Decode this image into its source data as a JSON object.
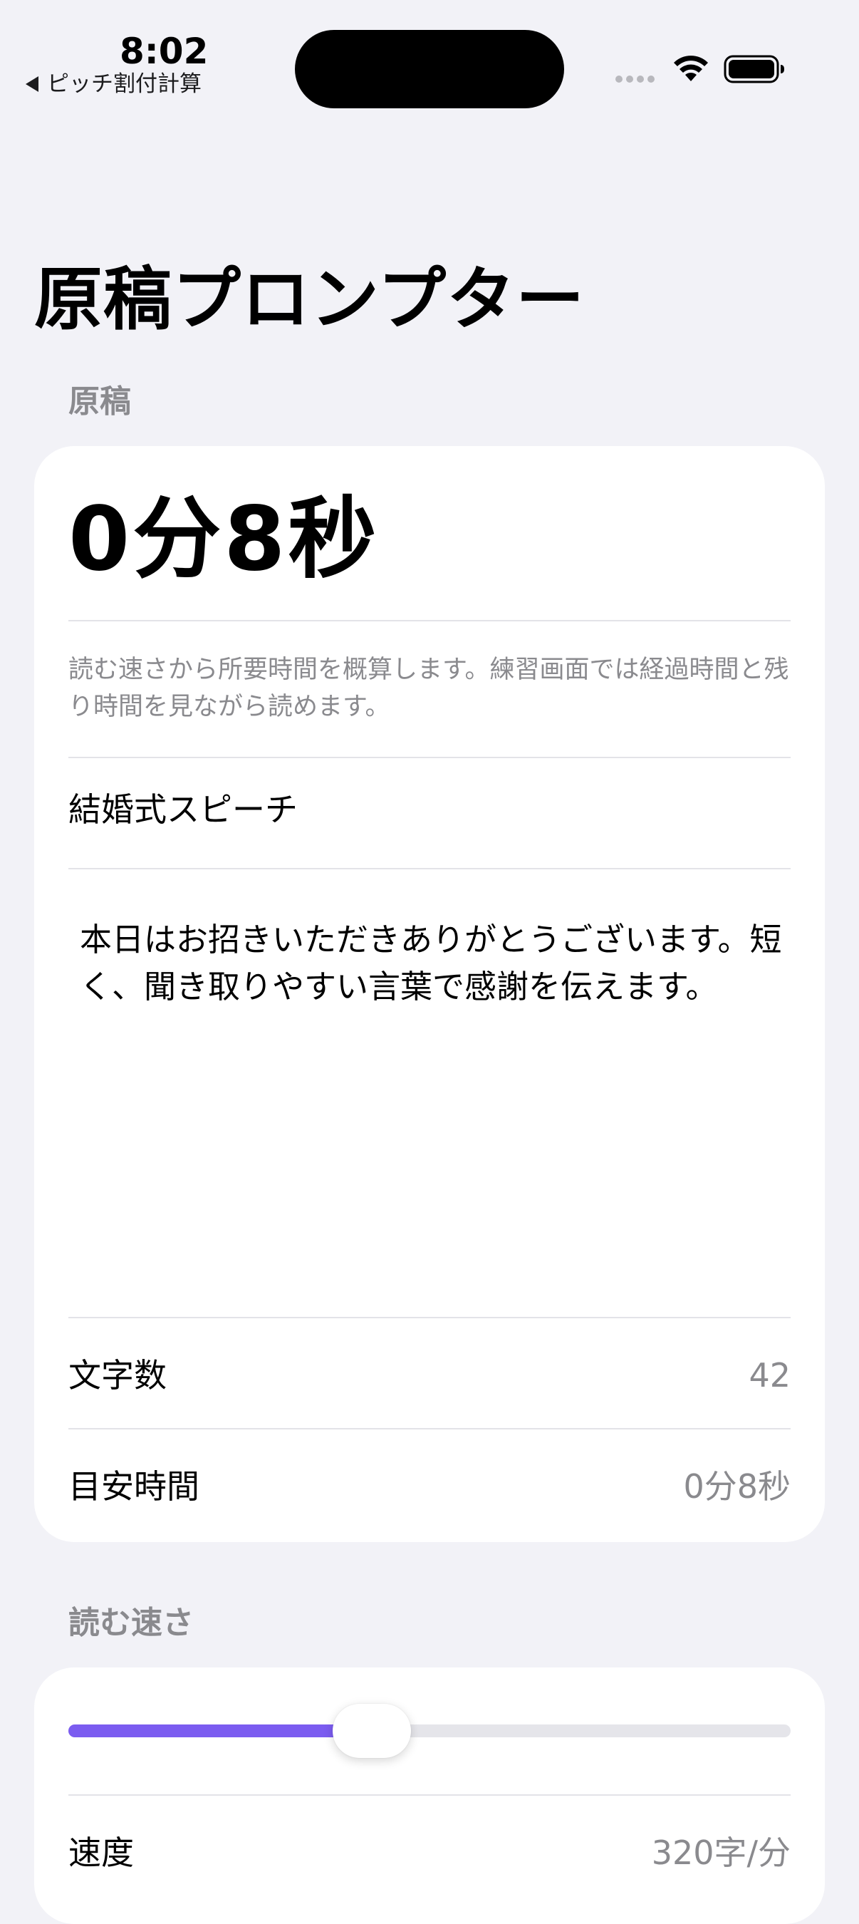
{
  "status_bar": {
    "time": "8:02",
    "back_label": "ピッチ割付計算"
  },
  "page": {
    "title": "原稿プロンプター"
  },
  "script_section": {
    "header": "原稿",
    "estimated_time_big": "0分8秒",
    "description": "読む速さから所要時間を概算します。練習画面では経過時間と残り時間を見ながら読めます。",
    "title_value": "結婚式スピーチ",
    "body_text": "本日はお招きいただきありがとうございます。短く、聞き取りやすい言葉で感謝を伝えます。",
    "char_count_label": "文字数",
    "char_count_value": "42",
    "est_time_label": "目安時間",
    "est_time_value": "0分8秒"
  },
  "speed_section": {
    "header": "読む速さ",
    "slider_fraction": 0.42,
    "speed_label": "速度",
    "speed_value": "320字/分"
  },
  "colors": {
    "accent": "#7b5cf0",
    "background": "#f2f2f7",
    "secondary_text": "#8a8a8e"
  }
}
